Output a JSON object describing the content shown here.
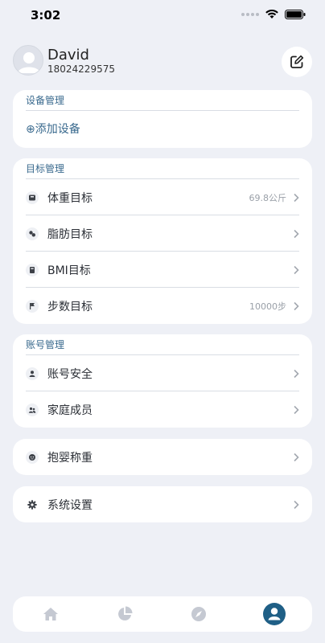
{
  "status_bar": {
    "time": "3:02"
  },
  "profile": {
    "name": "David",
    "phone": "18024229575"
  },
  "device_section": {
    "title": "设备管理",
    "add_label": "⊕添加设备"
  },
  "goal_section": {
    "title": "目标管理",
    "items": [
      {
        "label": "体重目标",
        "value": "69.8公斤",
        "icon": "scale-icon"
      },
      {
        "label": "脂肪目标",
        "value": "",
        "icon": "fat-icon"
      },
      {
        "label": "BMI目标",
        "value": "",
        "icon": "bmi-icon"
      },
      {
        "label": "步数目标",
        "value": "10000步",
        "icon": "flag-icon"
      }
    ]
  },
  "account_section": {
    "title": "账号管理",
    "items": [
      {
        "label": "账号安全",
        "icon": "person-icon"
      },
      {
        "label": "家庭成员",
        "icon": "family-icon"
      }
    ]
  },
  "baby_weigh": {
    "label": "抱婴称重",
    "icon": "baby-icon"
  },
  "settings": {
    "label": "系统设置",
    "icon": "gear-icon"
  },
  "tab_bar": {
    "tabs": [
      {
        "icon": "home-icon",
        "active": false
      },
      {
        "icon": "pie-chart-icon",
        "active": false
      },
      {
        "icon": "compass-icon",
        "active": false
      },
      {
        "icon": "profile-icon",
        "active": true
      }
    ],
    "active_color": "#1f5f86",
    "inactive_color": "#c5c9d2"
  },
  "colors": {
    "background": "#eef0f6",
    "accent": "#3a6a8e"
  }
}
